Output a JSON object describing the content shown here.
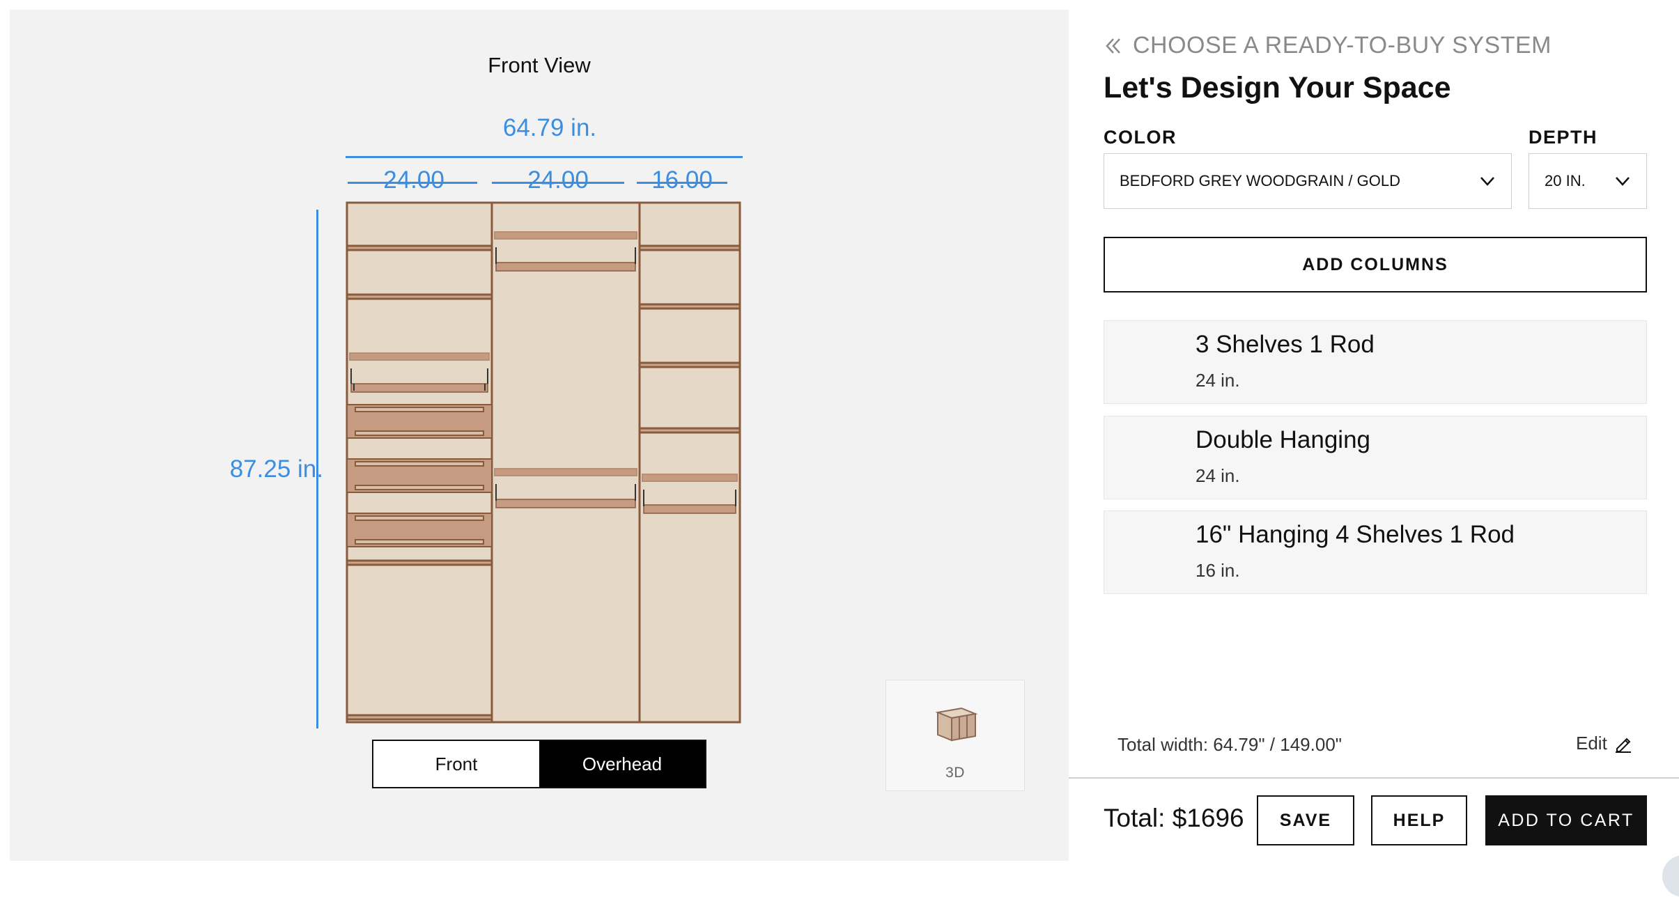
{
  "canvas": {
    "view_title": "Front View",
    "total_width": "64.79 in.",
    "column_widths": [
      "24.00",
      "24.00",
      "16.00"
    ],
    "total_height": "87.25 in.",
    "view_toggle": {
      "front": "Front",
      "overhead": "Overhead",
      "selected": "overhead"
    },
    "threed_label": "3D"
  },
  "panel": {
    "back_link": "CHOOSE A READY-TO-BUY SYSTEM",
    "title": "Let's Design Your Space",
    "color": {
      "label": "COLOR",
      "value": "BEDFORD GREY WOODGRAIN / GOLD"
    },
    "depth": {
      "label": "DEPTH",
      "value": "20 IN."
    },
    "add_columns": "ADD COLUMNS",
    "columns": [
      {
        "title": "3 Shelves 1 Rod",
        "width": "24 in."
      },
      {
        "title": "Double Hanging",
        "width": "24 in."
      },
      {
        "title": "16\" Hanging 4 Shelves 1 Rod",
        "width": "16 in."
      }
    ],
    "total_width": "Total width: 64.79\" / 149.00\"",
    "edit": "Edit"
  },
  "footer": {
    "total_label": "Total:",
    "total_value": "$1696",
    "save": "SAVE",
    "help": "HELP",
    "add_to_cart": "ADD TO CART"
  },
  "colors": {
    "accent_blue": "#3b8de0",
    "panel_fill": "#e5d8c6",
    "drawer_fill": "#c59c81",
    "frame": "#8a5a3c",
    "button_black": "#111111"
  },
  "icons": [
    "double-chevron-left-icon",
    "chevron-down-icon",
    "pencil-icon",
    "cabinet-3d-icon"
  ]
}
